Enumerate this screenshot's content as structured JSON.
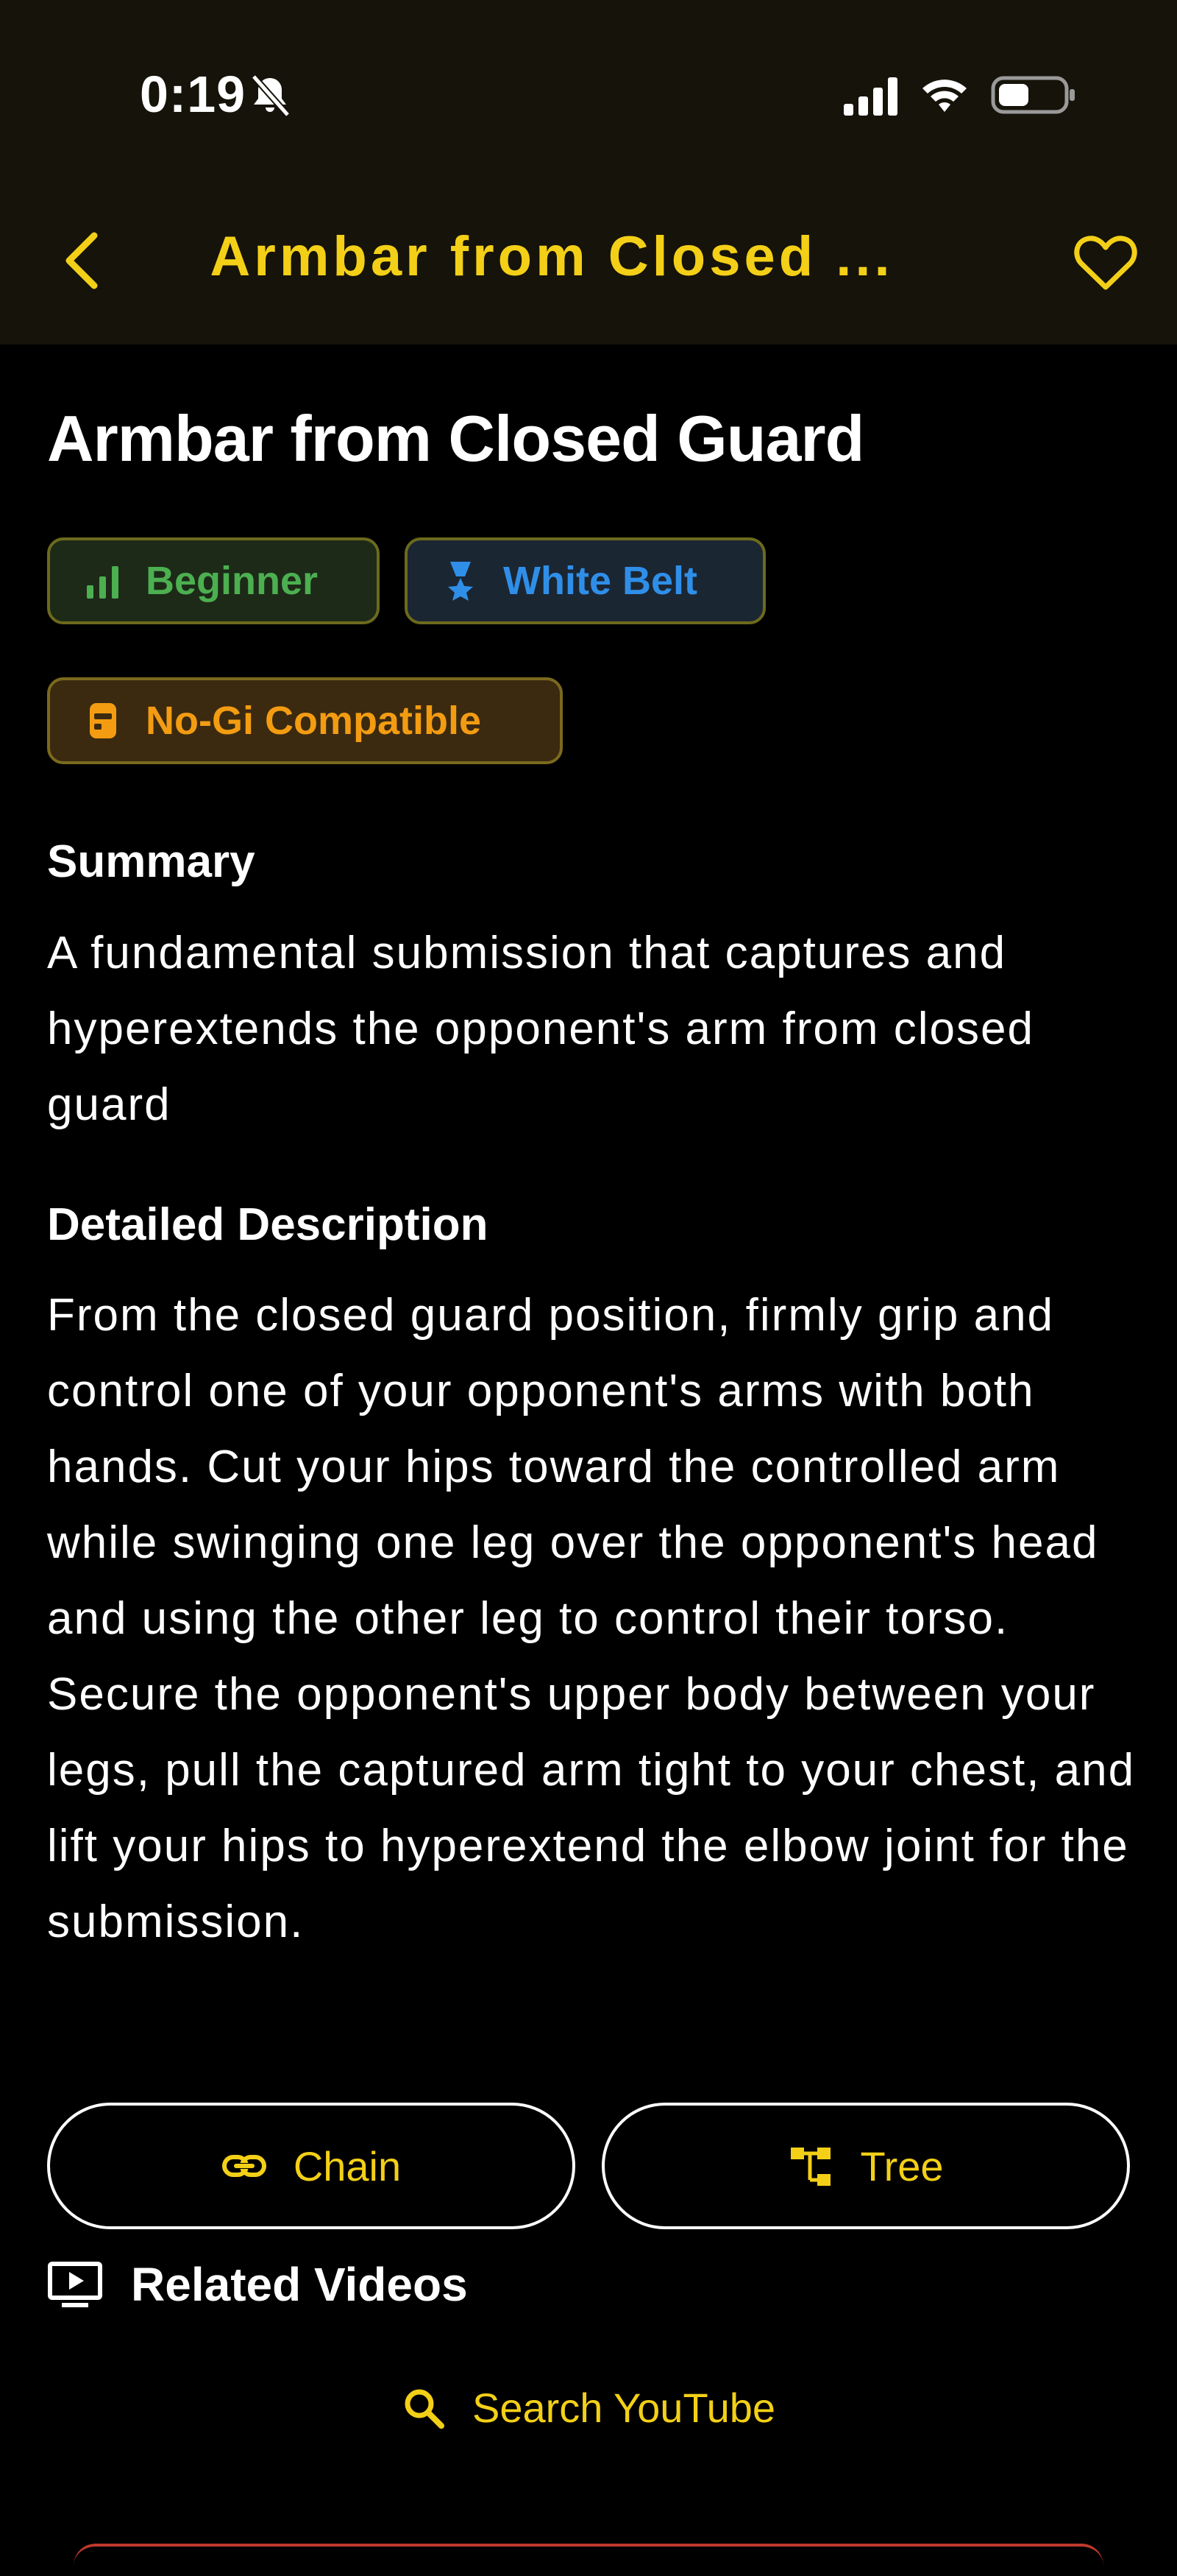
{
  "status_bar": {
    "time": "0:19",
    "icons": [
      "bell-slash-icon",
      "signal-icon",
      "wifi-icon",
      "battery-icon"
    ]
  },
  "nav": {
    "title": "Armbar from Closed ...",
    "back_icon": "chevron-left-icon",
    "favorite_icon": "heart-icon"
  },
  "technique": {
    "title": "Armbar from Closed Guard",
    "chips": {
      "level": "Beginner",
      "belt": "White Belt",
      "nogi": "No-Gi Compatible"
    },
    "summary_heading": "Summary",
    "summary": "A fundamental submission that captures and hyperextends the opponent's arm from closed guard",
    "description_heading": "Detailed Description",
    "description": "From the closed guard position, firmly grip and control one of your opponent's arms with both hands. Cut your hips toward the controlled arm while swinging one leg over the opponent's head and using the other leg to control their torso. Secure the opponent's upper body between your legs, pull the captured arm tight to your chest, and lift your hips to hyperextend the elbow joint for the submission."
  },
  "actions": {
    "chain_label": "Chain",
    "tree_label": "Tree"
  },
  "related": {
    "heading": "Related Videos",
    "search_label": "Search YouTube"
  },
  "colors": {
    "accent": "#f3d017",
    "beginner": "#4caf50",
    "belt": "#2f8fe8",
    "nogi": "#f39c12",
    "background": "#000000",
    "header": "#16130a"
  }
}
